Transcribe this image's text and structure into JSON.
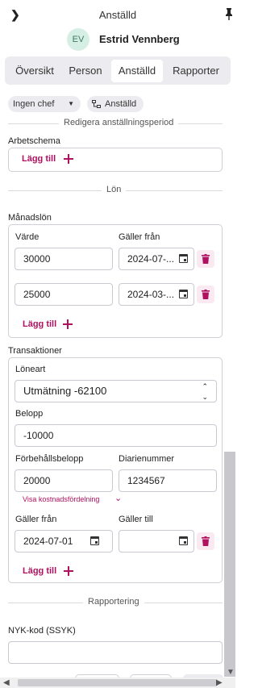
{
  "header": {
    "title": "Anställd",
    "avatar_initials": "EV",
    "employee_name": "Estrid Vennberg"
  },
  "tabs": [
    {
      "label": "Översikt",
      "active": false
    },
    {
      "label": "Person",
      "active": false
    },
    {
      "label": "Anställd",
      "active": true
    },
    {
      "label": "Rapporter",
      "active": false
    }
  ],
  "filters": {
    "manager_chip": "Ingen chef",
    "org_chip": "Anställd"
  },
  "section_edit_period": "Redigera anställningsperiod",
  "work_schedule": {
    "label": "Arbetschema",
    "add_label": "Lägg till"
  },
  "section_salary": "Lön",
  "monthly_salary": {
    "label": "Månadslön",
    "col_value": "Värde",
    "col_valid_from": "Gäller från",
    "rows": [
      {
        "value": "30000",
        "valid_from": "2024-07-..."
      },
      {
        "value": "25000",
        "valid_from": "2024-03-..."
      }
    ],
    "add_label": "Lägg till"
  },
  "transactions": {
    "label": "Transaktioner",
    "pay_type_label": "Löneart",
    "pay_type_value": "Utmätning -62100",
    "amount_label": "Belopp",
    "amount_value": "-10000",
    "reserved_amount_label": "Förbehållsbelopp",
    "reserved_amount_value": "20000",
    "diary_number_label": "Diarienummer",
    "diary_number_value": "1234567",
    "cost_distribution_link": "Visa kostnadsfördelning",
    "valid_from_label": "Gäller från",
    "valid_from_value": "2024-07-01",
    "valid_to_label": "Gäller till",
    "valid_to_value": "",
    "add_label": "Lägg till"
  },
  "section_reporting": "Rapportering",
  "nyk_label": "NYK-kod (SSYK)",
  "nyk_value": "",
  "colors": {
    "accent": "#b0105f",
    "tab_bg": "#ececf0",
    "avatar_bg": "#d5efe5"
  }
}
